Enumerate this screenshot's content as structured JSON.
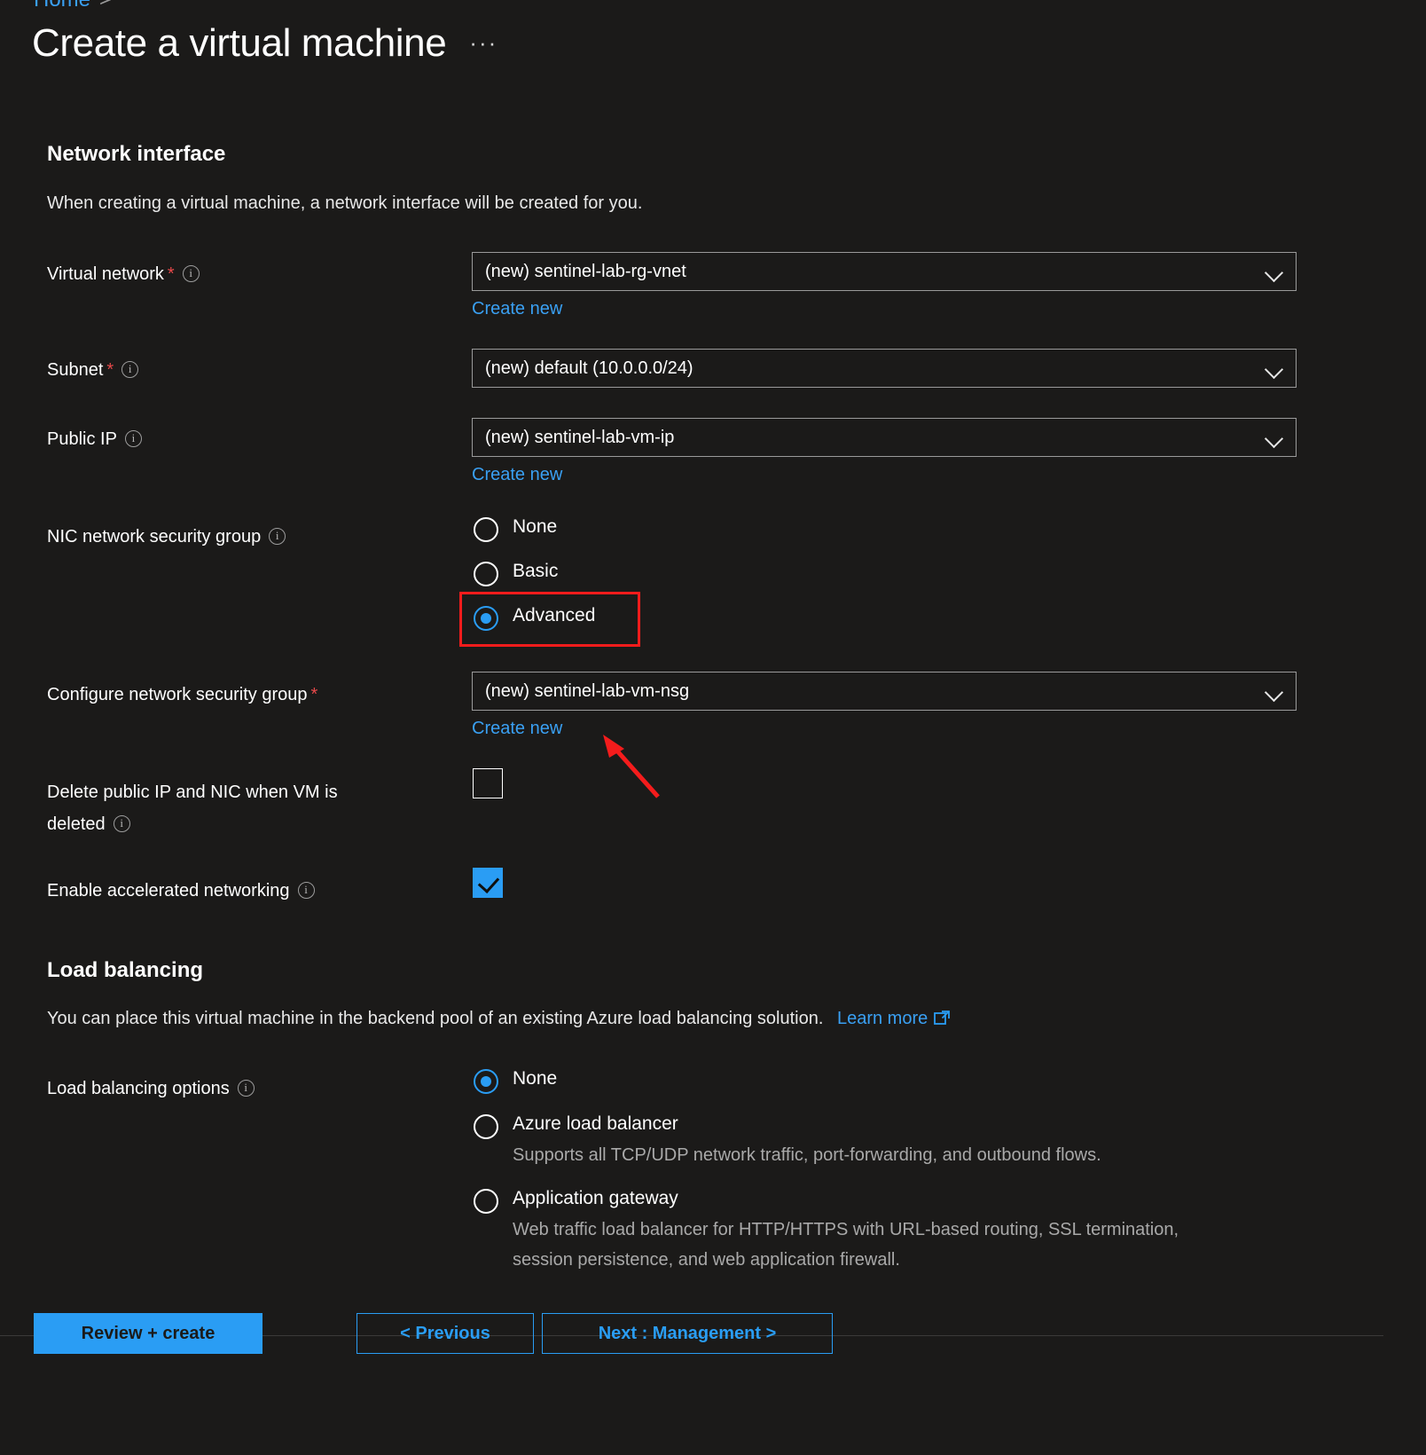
{
  "breadcrumb": {
    "home": "Home",
    "separator": ">"
  },
  "header": {
    "title": "Create a virtual machine",
    "more_label": "···"
  },
  "network_interface": {
    "heading": "Network interface",
    "description": "When creating a virtual machine, a network interface will be created for you.",
    "virtual_network": {
      "label": "Virtual network",
      "required": "*",
      "value": "(new) sentinel-lab-rg-vnet",
      "create_new": "Create new"
    },
    "subnet": {
      "label": "Subnet",
      "required": "*",
      "value": "(new) default (10.0.0.0/24)"
    },
    "public_ip": {
      "label": "Public IP",
      "value": "(new) sentinel-lab-vm-ip",
      "create_new": "Create new"
    },
    "nic_nsg": {
      "label": "NIC network security group",
      "options": [
        {
          "label": "None",
          "selected": false
        },
        {
          "label": "Basic",
          "selected": false
        },
        {
          "label": "Advanced",
          "selected": true
        }
      ]
    },
    "configure_nsg": {
      "label": "Configure network security group",
      "required": "*",
      "value": "(new) sentinel-lab-vm-nsg",
      "create_new": "Create new"
    },
    "delete_ip_nic": {
      "label_line1": "Delete public IP and NIC when VM is",
      "label_line2": "deleted",
      "checked": false
    },
    "accelerated_networking": {
      "label": "Enable accelerated networking",
      "checked": true
    }
  },
  "load_balancing": {
    "heading": "Load balancing",
    "description": "You can place this virtual machine in the backend pool of an existing Azure load balancing solution.",
    "learn_more": "Learn more",
    "options_label": "Load balancing options",
    "options": [
      {
        "label": "None",
        "selected": true,
        "description": ""
      },
      {
        "label": "Azure load balancer",
        "selected": false,
        "description": "Supports all TCP/UDP network traffic, port-forwarding, and outbound flows."
      },
      {
        "label": "Application gateway",
        "selected": false,
        "description": "Web traffic load balancer for HTTP/HTTPS with URL-based routing, SSL termination, session persistence, and web application firewall."
      }
    ]
  },
  "footer": {
    "review_create": "Review + create",
    "previous": "< Previous",
    "next": "Next : Management >"
  },
  "colors": {
    "background": "#1b1a19",
    "accent_blue": "#2a9df4",
    "link_blue": "#3aa0f3",
    "required_red": "#e8494a",
    "annotation_red": "#f41c1c",
    "muted_text": "#a9a9a9"
  },
  "annotations": {
    "highlight_target": "Advanced",
    "arrow_target": "Create new"
  }
}
